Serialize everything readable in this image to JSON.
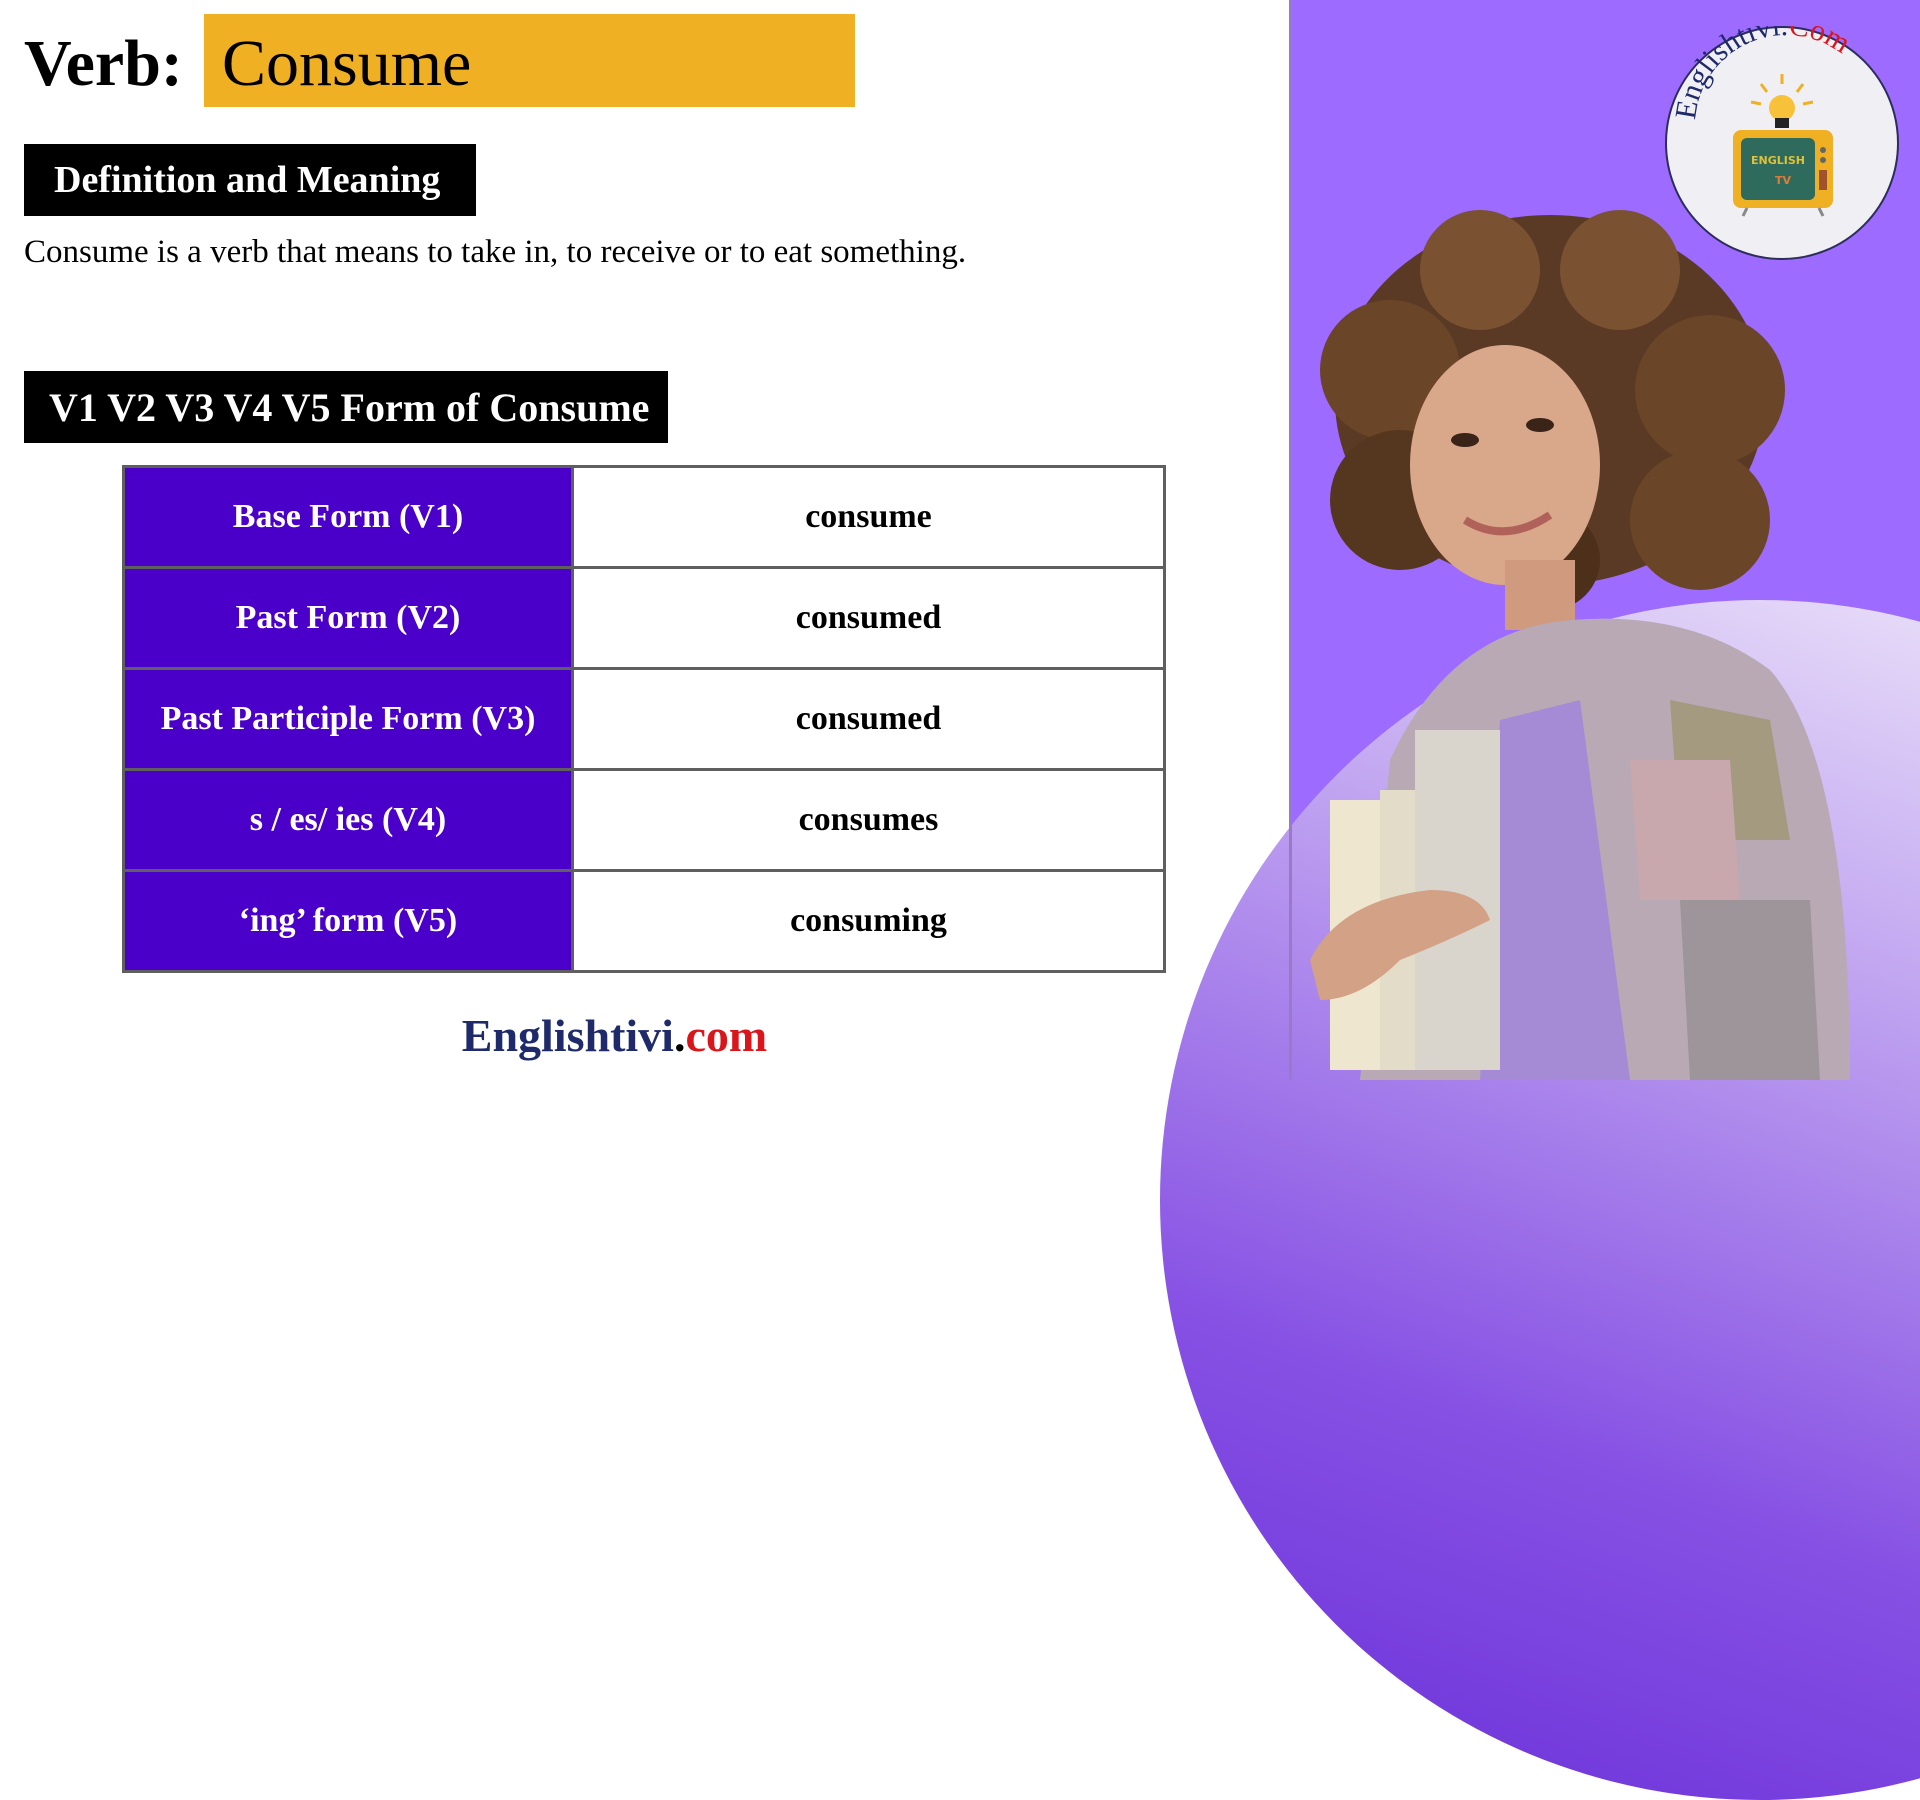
{
  "title": {
    "prefix": "Verb:",
    "word": "Consume"
  },
  "definition": {
    "header": "Definition and Meaning",
    "text": "Consume is a verb that means to take in, to receive or to eat something."
  },
  "forms": {
    "header": "V1 V2 V3 V4 V5 Form of Consume",
    "rows": [
      {
        "label": "Base Form (V1)",
        "value": "consume"
      },
      {
        "label": "Past Form (V2)",
        "value": "consumed"
      },
      {
        "label": "Past Participle Form (V3)",
        "value": "consumed"
      },
      {
        "label": "s / es/ ies (V4)",
        "value": "consumes"
      },
      {
        "label": "‘ing’ form (V5)",
        "value": "consuming"
      }
    ]
  },
  "footer": {
    "brand_main": "Englishtivi",
    "brand_dot": ".",
    "brand_tld": "com"
  },
  "logo": {
    "text_main": "Englishtivi.",
    "text_tld": "Com",
    "screen_text_1": "ENGLISH",
    "screen_text_2": "TV",
    "icons": [
      "light-bulb-icon",
      "television-icon"
    ]
  },
  "colors": {
    "title_highlight": "#f0b023",
    "table_label_bg": "#4a00c8",
    "panel_purple": "#9d6bff",
    "brand_blue": "#1f2a6b",
    "brand_red": "#d9161b"
  }
}
